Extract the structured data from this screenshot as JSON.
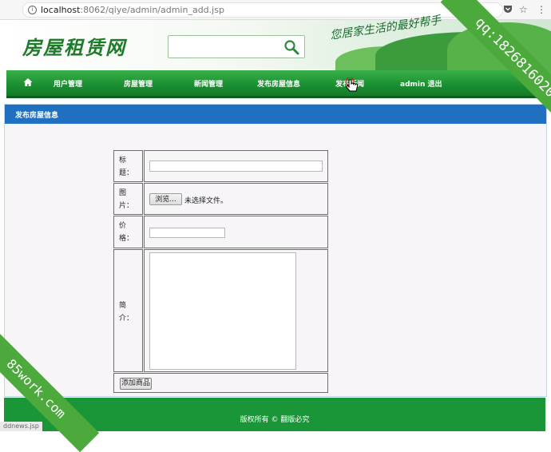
{
  "browser": {
    "url_host": "localhost",
    "url_rest": ":8062/qiye/admin/admin_add.jsp",
    "pocket_icon": "pocket-icon",
    "star_icon": "star-icon"
  },
  "header": {
    "logo": "房屋租赁网",
    "search_placeholder": "",
    "slogan": "您居家生活的最好帮手"
  },
  "nav": {
    "items": [
      {
        "label": "用户管理"
      },
      {
        "label": "房屋管理"
      },
      {
        "label": "新闻管理"
      },
      {
        "label": "发布房屋信息"
      },
      {
        "label": "发布新闻"
      },
      {
        "label": "admin 退出"
      }
    ]
  },
  "panel": {
    "title": "发布房屋信息"
  },
  "form": {
    "title_label": "标题：",
    "title_value": "",
    "image_label": "图片：",
    "browse_label": "浏览...",
    "no_file_text": "未选择文件。",
    "price_label": "价格：",
    "price_value": "",
    "intro_label": "简介：",
    "intro_value": "",
    "submit_label": "添加商品"
  },
  "footer": {
    "text": "版权所有 © 翻版必究"
  },
  "watermarks": {
    "qq": "qq:1826816020",
    "site": "85work.com"
  },
  "status_link": "ddnews.jsp"
}
